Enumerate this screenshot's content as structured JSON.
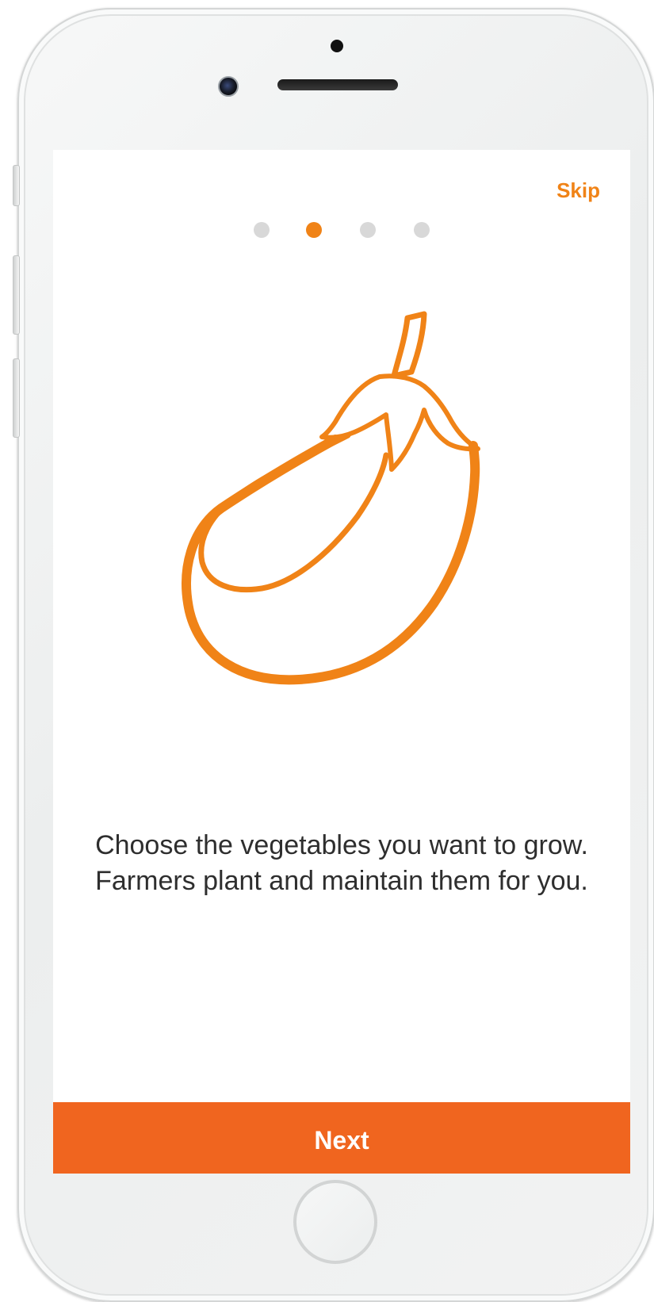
{
  "onboarding": {
    "skip_label": "Skip",
    "pager": {
      "total": 4,
      "active_index": 1
    },
    "illustration_icon": "eggplant-icon",
    "caption_lines": [
      "Choose the vegetables you want to grow.",
      "Farmers plant and maintain them for you."
    ],
    "next_label": "Next"
  },
  "colors": {
    "accent": "#f08317",
    "button": "#f0651f",
    "dot_inactive": "#d8d8d8",
    "text": "#2e2e2e"
  }
}
